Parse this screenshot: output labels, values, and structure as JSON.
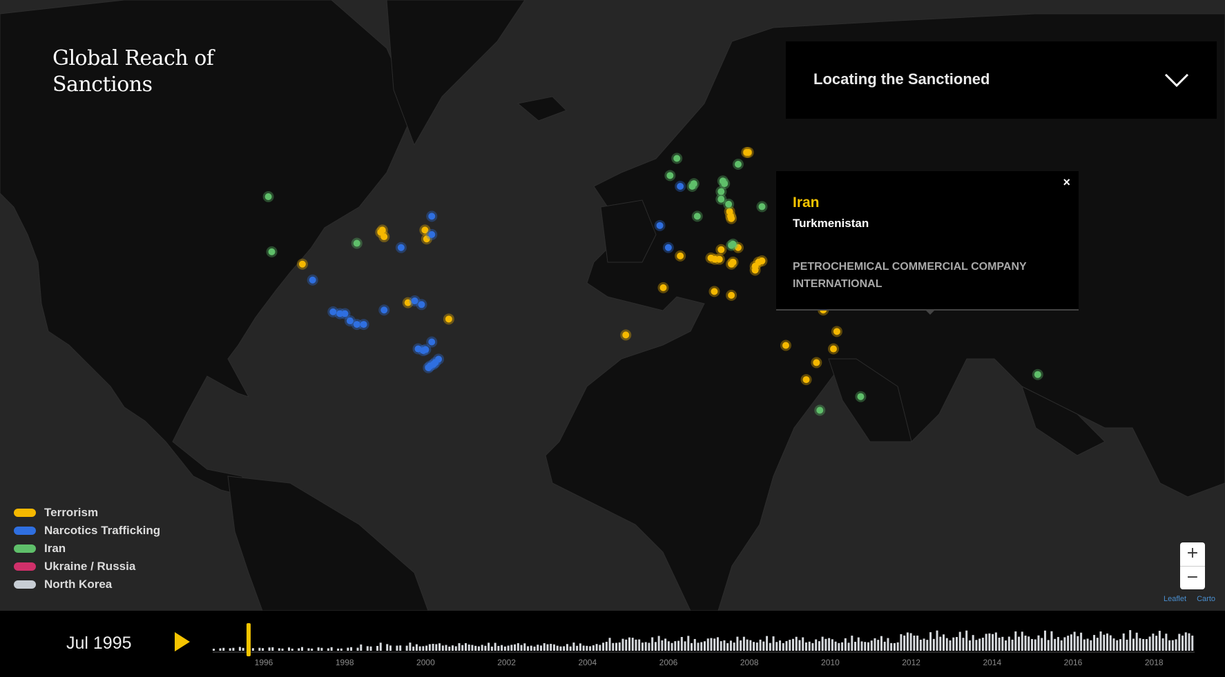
{
  "title": "Global Reach of Sanctions",
  "story_selector": {
    "label": "Locating the Sanctioned"
  },
  "popup": {
    "program": "Iran",
    "country": "Turkmenistan",
    "entity": "PETROCHEMICAL COMMERCIAL COMPANY INTERNATIONAL",
    "close": "×"
  },
  "legend": [
    {
      "label": "Terrorism",
      "color": "#f5b800"
    },
    {
      "label": "Narcotics Trafficking",
      "color": "#2f6fe0"
    },
    {
      "label": "Iran",
      "color": "#5fbf6a"
    },
    {
      "label": "Ukraine / Russia",
      "color": "#d0306a"
    },
    {
      "label": "North Korea",
      "color": "#c7cdd4"
    }
  ],
  "zoom": {
    "in": "+",
    "out": "−"
  },
  "attribution": {
    "leaflet": "Leaflet",
    "carto": "Carto"
  },
  "timeline": {
    "current_date": "Jul 1995",
    "years": [
      "1996",
      "1998",
      "2000",
      "2002",
      "2004",
      "2006",
      "2008",
      "2010",
      "2012",
      "2014",
      "2016",
      "2018"
    ],
    "playhead_color": "#f5c400"
  },
  "markers": {
    "terrorism": [
      [
        40.5,
        -90
      ],
      [
        41,
        -89.5
      ],
      [
        39.5,
        -89
      ],
      [
        41,
        -77
      ],
      [
        39,
        -76.5
      ],
      [
        33,
        -113
      ],
      [
        23,
        -82
      ],
      [
        18.5,
        -70
      ],
      [
        56,
        17.5
      ],
      [
        56,
        18
      ],
      [
        45,
        12.5
      ],
      [
        44,
        12.8
      ],
      [
        43.5,
        13
      ],
      [
        36.5,
        10
      ],
      [
        34.5,
        7
      ],
      [
        34.2,
        8.2
      ],
      [
        34.2,
        9.5
      ],
      [
        33.5,
        13.5
      ],
      [
        33,
        13
      ],
      [
        33.5,
        21
      ],
      [
        33.8,
        22
      ],
      [
        32.5,
        20
      ],
      [
        31.5,
        20
      ],
      [
        31,
        30.5
      ],
      [
        37,
        15
      ],
      [
        35,
        -2
      ],
      [
        27,
        -7
      ],
      [
        26,
        8
      ],
      [
        25,
        13
      ],
      [
        32,
        35
      ],
      [
        33.5,
        36
      ],
      [
        34,
        37
      ],
      [
        31.5,
        35
      ],
      [
        32,
        36.5
      ],
      [
        33,
        44
      ],
      [
        26,
        28
      ],
      [
        25,
        50.5
      ],
      [
        23,
        58
      ],
      [
        21,
        40
      ],
      [
        15,
        44
      ],
      [
        14,
        -18
      ],
      [
        11,
        29
      ],
      [
        10,
        43
      ],
      [
        6,
        38
      ],
      [
        1,
        35
      ],
      [
        33,
        72
      ],
      [
        31,
        75
      ],
      [
        28,
        77
      ]
    ],
    "narcotics": [
      [
        44,
        -75
      ],
      [
        40,
        -75
      ],
      [
        37,
        -84
      ],
      [
        29,
        -110
      ],
      [
        20.5,
        -104
      ],
      [
        20,
        -102
      ],
      [
        20,
        -100.5
      ],
      [
        18,
        -99
      ],
      [
        17,
        -97
      ],
      [
        17,
        -95
      ],
      [
        21,
        -89
      ],
      [
        23.5,
        -80
      ],
      [
        22.5,
        -78
      ],
      [
        12,
        -75
      ],
      [
        10,
        -79
      ],
      [
        9.5,
        -77.5
      ],
      [
        9.8,
        -76.8
      ],
      [
        7,
        -73
      ],
      [
        6,
        -74
      ],
      [
        5,
        -75.5
      ],
      [
        4.5,
        -76
      ],
      [
        5.5,
        -74.5
      ],
      [
        50,
        -2
      ],
      [
        42,
        -8
      ],
      [
        37,
        -5.5
      ]
    ],
    "iran": [
      [
        48,
        -123
      ],
      [
        36,
        -122
      ],
      [
        38,
        -97
      ],
      [
        55,
        -3
      ],
      [
        52,
        -5
      ],
      [
        50,
        1.5
      ],
      [
        50.5,
        2
      ],
      [
        51,
        10.5
      ],
      [
        50.5,
        11
      ],
      [
        54,
        15
      ],
      [
        49,
        10
      ],
      [
        47.5,
        10
      ],
      [
        46.5,
        12.2
      ],
      [
        44,
        3
      ],
      [
        46,
        22
      ],
      [
        37.5,
        13
      ],
      [
        37.8,
        13.5
      ],
      [
        34,
        37.5
      ],
      [
        36.5,
        50
      ],
      [
        36,
        50
      ],
      [
        40,
        58
      ],
      [
        34,
        51
      ],
      [
        27,
        52
      ],
      [
        26.5,
        54
      ],
      [
        26,
        55.5
      ],
      [
        26.2,
        54.8
      ],
      [
        25.8,
        55.2
      ],
      [
        30,
        69
      ],
      [
        -8,
        39
      ],
      [
        -4,
        51
      ],
      [
        2.5,
        103
      ]
    ]
  }
}
